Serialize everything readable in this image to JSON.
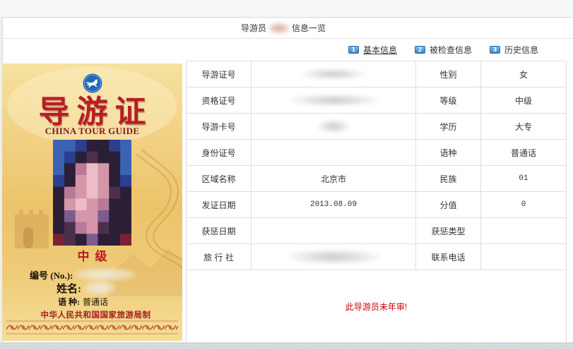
{
  "header": {
    "title_prefix": "导游员",
    "title_suffix": "信息一览"
  },
  "tabs": [
    {
      "number": "1",
      "label": "基本信息",
      "active": true
    },
    {
      "number": "2",
      "label": "被检查信息",
      "active": false
    },
    {
      "number": "3",
      "label": "历史信息",
      "active": false
    }
  ],
  "card": {
    "logo_icon": "horse-emblem-icon",
    "title": "导游证",
    "subtitle": "CHINA TOUR GUIDE",
    "level": "中级",
    "number_label": "编号 (No.):",
    "name_label": "姓名:",
    "language_label": "语 种:",
    "language_value": "普通话",
    "issuer": "中华人民共和国国家旅游局制"
  },
  "info_table": {
    "rows": [
      {
        "label": "导游证号",
        "value": "",
        "label2": "性别",
        "value2": "女"
      },
      {
        "label": "资格证号",
        "value": "",
        "label2": "等级",
        "value2": "中级"
      },
      {
        "label": "导游卡号",
        "value": "",
        "label2": "学历",
        "value2": "大专"
      },
      {
        "label": "身份证号",
        "value": "",
        "label2": "语种",
        "value2": "普通话"
      },
      {
        "label": "区域名称",
        "value": "北京市",
        "label2": "民族",
        "value2": "01"
      },
      {
        "label": "发证日期",
        "value": "2013.08.09",
        "label2": "分值",
        "value2": "0"
      },
      {
        "label": "获惩日期",
        "value": "",
        "label2": "获惩类型",
        "value2": ""
      },
      {
        "label": "旅 行 社",
        "value": "",
        "label2": "联系电话",
        "value2": ""
      }
    ],
    "notice": "此导游员未年审!"
  },
  "colors": {
    "notice_text": "#cc0000",
    "badge_blue": "#3b86cc",
    "card_title_red": "#b61e24",
    "table_border": "#dedede"
  }
}
